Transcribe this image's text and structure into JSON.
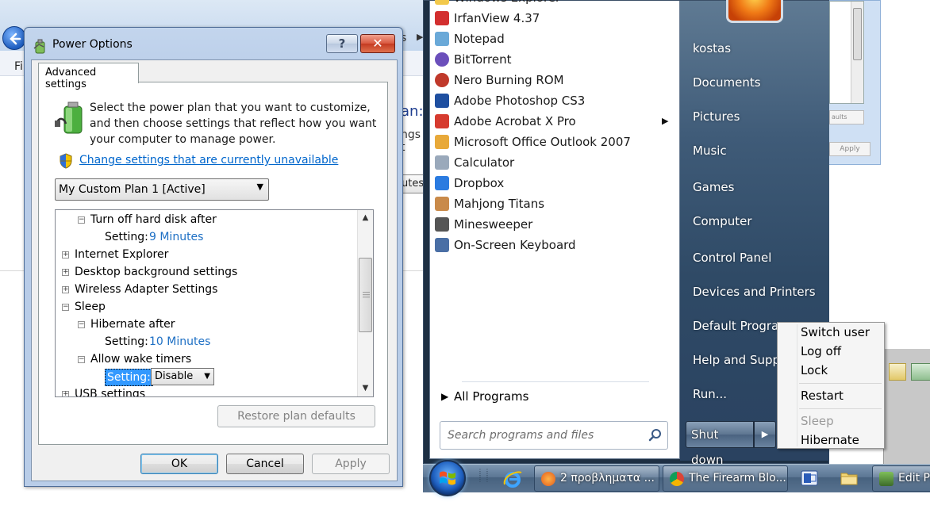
{
  "background_explorer": {
    "menu_fragment": "Fi",
    "peek_tail": "s",
    "peek_arrow": "▶",
    "peek_plan": "an:",
    "peek_ngs": "ngs t",
    "peek_button": "utes"
  },
  "background_right": {
    "button1": "aults",
    "button2": "Apply"
  },
  "power_dialog": {
    "title": "Power Options",
    "help_label": "?",
    "close_label": "✕",
    "tab": "Advanced settings",
    "description": "Select the power plan that you want to customize, and then choose settings that reflect how you want your computer to manage power.",
    "change_link": "Change settings that are currently unavailable",
    "plan_select": "My Custom Plan 1 [Active]",
    "tree": [
      {
        "box": "−",
        "label": "Turn off hard disk after",
        "level": 1
      },
      {
        "label": "Setting:",
        "value": "9 Minutes",
        "level": 2
      },
      {
        "box": "+",
        "label": "Internet Explorer",
        "level": 0
      },
      {
        "box": "+",
        "label": "Desktop background settings",
        "level": 0
      },
      {
        "box": "+",
        "label": "Wireless Adapter Settings",
        "level": 0
      },
      {
        "box": "−",
        "label": "Sleep",
        "level": 0
      },
      {
        "box": "−",
        "label": "Hibernate after",
        "level": 1
      },
      {
        "label": "Setting:",
        "value": "10 Minutes",
        "level": 2
      },
      {
        "box": "−",
        "label": "Allow wake timers",
        "level": 1
      },
      {
        "label": "Setting:",
        "value": "Disable",
        "level": 2,
        "selected": true
      },
      {
        "box": "+",
        "label": "USB settings",
        "level": 0
      }
    ],
    "restore_button": "Restore plan defaults",
    "ok_button": "OK",
    "cancel_button": "Cancel",
    "apply_button": "Apply"
  },
  "start_menu": {
    "programs": [
      {
        "icon": "windows-explorer-icon",
        "label": "Windows Explorer"
      },
      {
        "icon": "irfanview-icon",
        "label": "IrfanView 4.37"
      },
      {
        "icon": "notepad-icon",
        "label": "Notepad"
      },
      {
        "icon": "bittorrent-icon",
        "label": "BitTorrent"
      },
      {
        "icon": "nero-icon",
        "label": "Nero Burning ROM"
      },
      {
        "icon": "photoshop-icon",
        "label": "Adobe Photoshop CS3"
      },
      {
        "icon": "acrobat-icon",
        "label": "Adobe Acrobat X Pro"
      },
      {
        "icon": "outlook-icon",
        "label": "Microsoft Office Outlook 2007"
      },
      {
        "icon": "calculator-icon",
        "label": "Calculator"
      },
      {
        "icon": "dropbox-icon",
        "label": "Dropbox"
      },
      {
        "icon": "mahjong-icon",
        "label": "Mahjong Titans"
      },
      {
        "icon": "minesweeper-icon",
        "label": "Minesweeper"
      },
      {
        "icon": "keyboard-icon",
        "label": "On-Screen Keyboard"
      }
    ],
    "submenu_arrow": "▶",
    "all_programs": "All Programs",
    "all_programs_arrow": "▶",
    "search_placeholder": "Search programs and files",
    "places": [
      "kostas",
      "Documents",
      "Pictures",
      "Music",
      "Games",
      "Computer",
      "Control Panel",
      "Devices and Printers",
      "Default Programs",
      "Help and Support",
      "Run..."
    ],
    "shutdown_button": "Shut down",
    "shutdown_arrow": "▶"
  },
  "shutdown_menu": {
    "items": [
      {
        "label": "Switch user",
        "enabled": true
      },
      {
        "label": "Log off",
        "enabled": true
      },
      {
        "label": "Lock",
        "enabled": true
      },
      {
        "label": "Restart",
        "enabled": true
      },
      {
        "label": "Sleep",
        "enabled": false
      },
      {
        "label": "Hibernate",
        "enabled": true
      }
    ]
  },
  "taskbar": {
    "tasks": [
      {
        "icon": "firefox-icon",
        "label": "2 προβληματα ..."
      },
      {
        "icon": "chrome-icon",
        "label": "The Firearm Blo..."
      },
      {
        "icon": "power-options-icon",
        "label": "Edit Pl"
      }
    ]
  },
  "colors": {
    "link": "#0066cc",
    "setting_value": "#1d6fc4",
    "selection": "#3399ff",
    "start_menu_dark": "#1d2f43"
  }
}
